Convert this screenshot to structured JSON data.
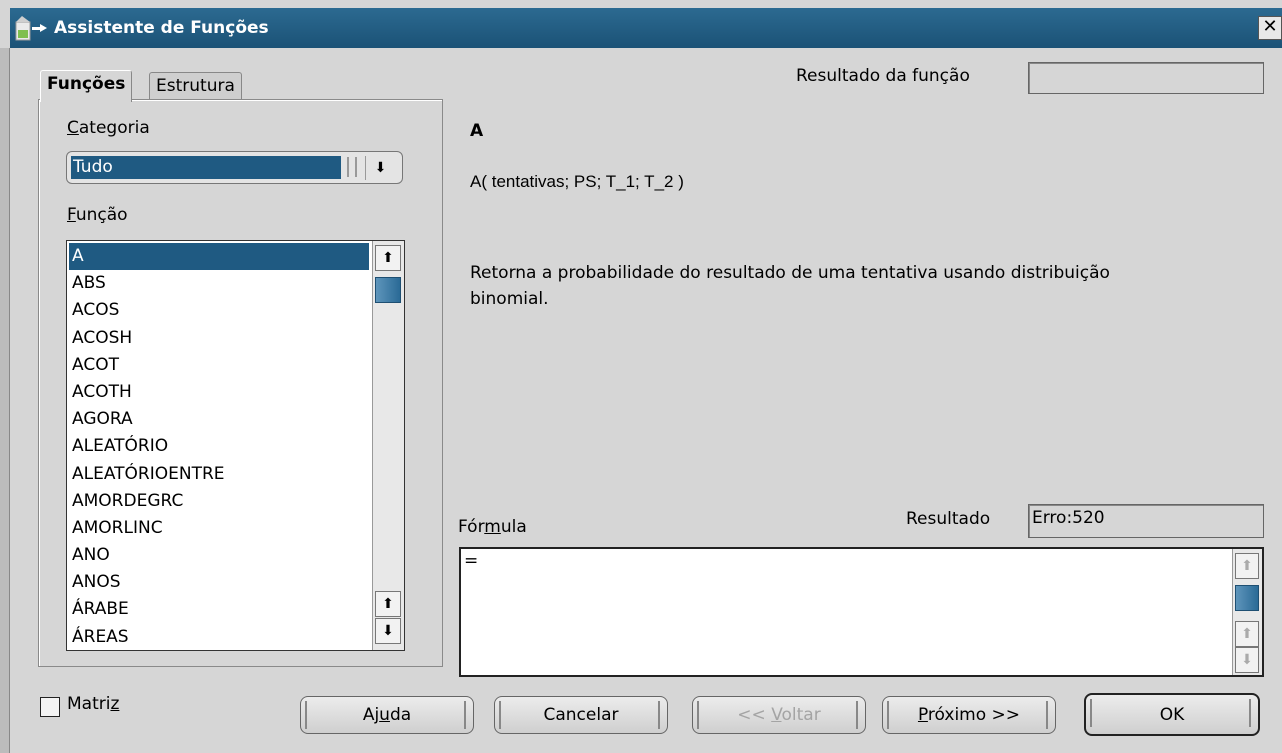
{
  "window": {
    "title": "Assistente de Funções",
    "close_glyph": "✕"
  },
  "tabs": [
    {
      "label": "Funções",
      "active": true
    },
    {
      "label": "Estrutura",
      "active": false
    }
  ],
  "category": {
    "label_first": "C",
    "label_rest": "ategoria",
    "value": "Tudo"
  },
  "function_list": {
    "label_first": "F",
    "label_rest": "unção",
    "items": [
      "A",
      "ABS",
      "ACOS",
      "ACOSH",
      "ACOT",
      "ACOTH",
      "AGORA",
      "ALEATÓRIO",
      "ALEATÓRIOENTRE",
      "AMORDEGRC",
      "AMORLINC",
      "ANO",
      "ANOS",
      "ÁRABE",
      "ÁREAS"
    ],
    "selected_index": 0
  },
  "function_result": {
    "label": "Resultado da função",
    "value": ""
  },
  "details": {
    "name": "A",
    "syntax": "A( tentativas; PS; T_1; T_2  )",
    "description": "Retorna a probabilidade do resultado de uma tentativa usando distribuição binomial."
  },
  "formula": {
    "label_pre": "Fór",
    "label_ul": "m",
    "label_post": "ula",
    "value": "=",
    "result_label": "Resultado",
    "result_value": "Erro:520"
  },
  "matrix": {
    "label_pre": "Matri",
    "label_ul": "z",
    "checked": false
  },
  "buttons": {
    "help_pre": "Aj",
    "help_ul": "u",
    "help_post": "da",
    "cancel": "Cancelar",
    "back_pre": "<< ",
    "back_ul": "V",
    "back_post": "oltar",
    "next_ul": "P",
    "next_post": "róximo >>",
    "ok": "OK"
  },
  "icons": {
    "up": "⬆",
    "down": "⬇",
    "combo_down": "⬇"
  }
}
